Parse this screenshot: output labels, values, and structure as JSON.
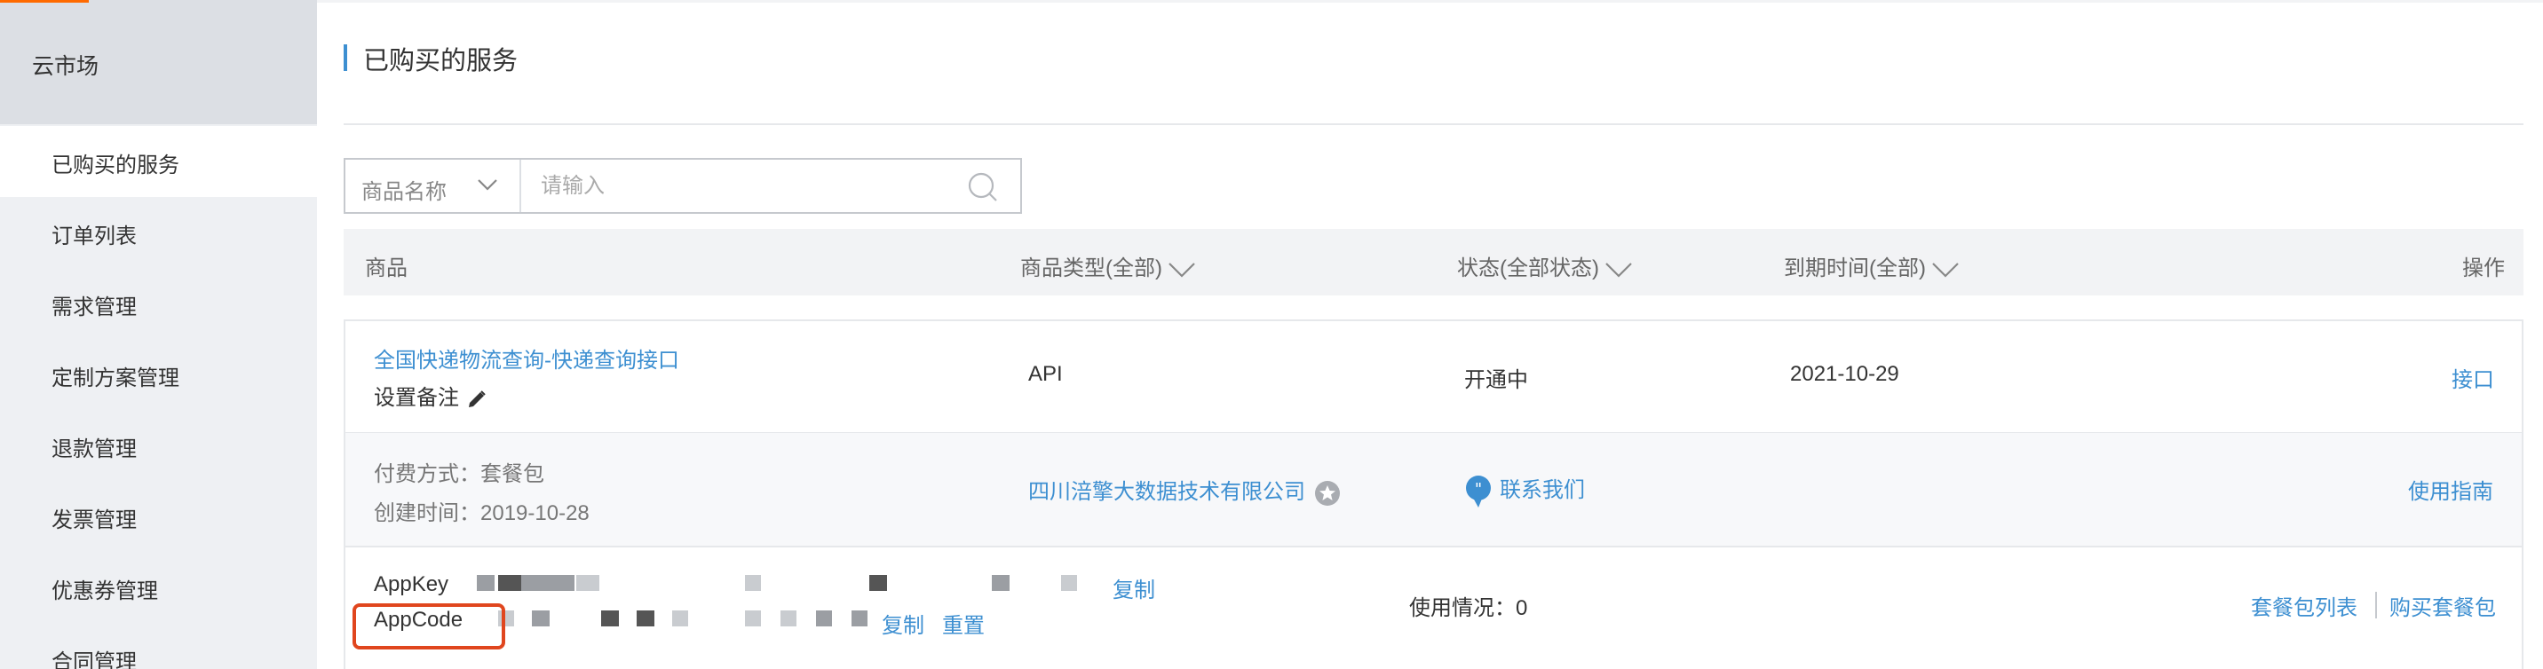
{
  "sidebar": {
    "header": "云市场",
    "items": [
      {
        "label": "已购买的服务",
        "active": true
      },
      {
        "label": "订单列表"
      },
      {
        "label": "需求管理"
      },
      {
        "label": "定制方案管理"
      },
      {
        "label": "退款管理"
      },
      {
        "label": "发票管理"
      },
      {
        "label": "优惠券管理"
      },
      {
        "label": "合同管理"
      }
    ]
  },
  "page": {
    "title": "已购买的服务"
  },
  "search": {
    "select_label": "商品名称",
    "placeholder": "请输入"
  },
  "table": {
    "headers": {
      "product": "商品",
      "type": "商品类型(全部)",
      "status": "状态(全部状态)",
      "expiry": "到期时间(全部)",
      "actions": "操作"
    },
    "row": {
      "name": "全国快递物流查询-快递查询接口",
      "note": "设置备注",
      "type": "API",
      "status": "开通中",
      "expiry": "2021-10-29",
      "action": "接口",
      "payment_label": "付费方式：",
      "payment_value": "套餐包",
      "created_label": "创建时间：",
      "created_value": "2019-10-28",
      "vendor": "四川涪擎大数据技术有限公司",
      "contact": "联系我们",
      "guide": "使用指南",
      "appkey_label": "AppKey",
      "appcode_label": "AppCode",
      "copy": "复制",
      "reset": "重置",
      "usage_label": "使用情况：",
      "usage_value": "0",
      "package_list": "套餐包列表",
      "buy_package": "购买套餐包"
    }
  },
  "colors": {
    "accent": "#ff6a00",
    "link": "#3d8fd1",
    "highlight": "#e0461e"
  }
}
